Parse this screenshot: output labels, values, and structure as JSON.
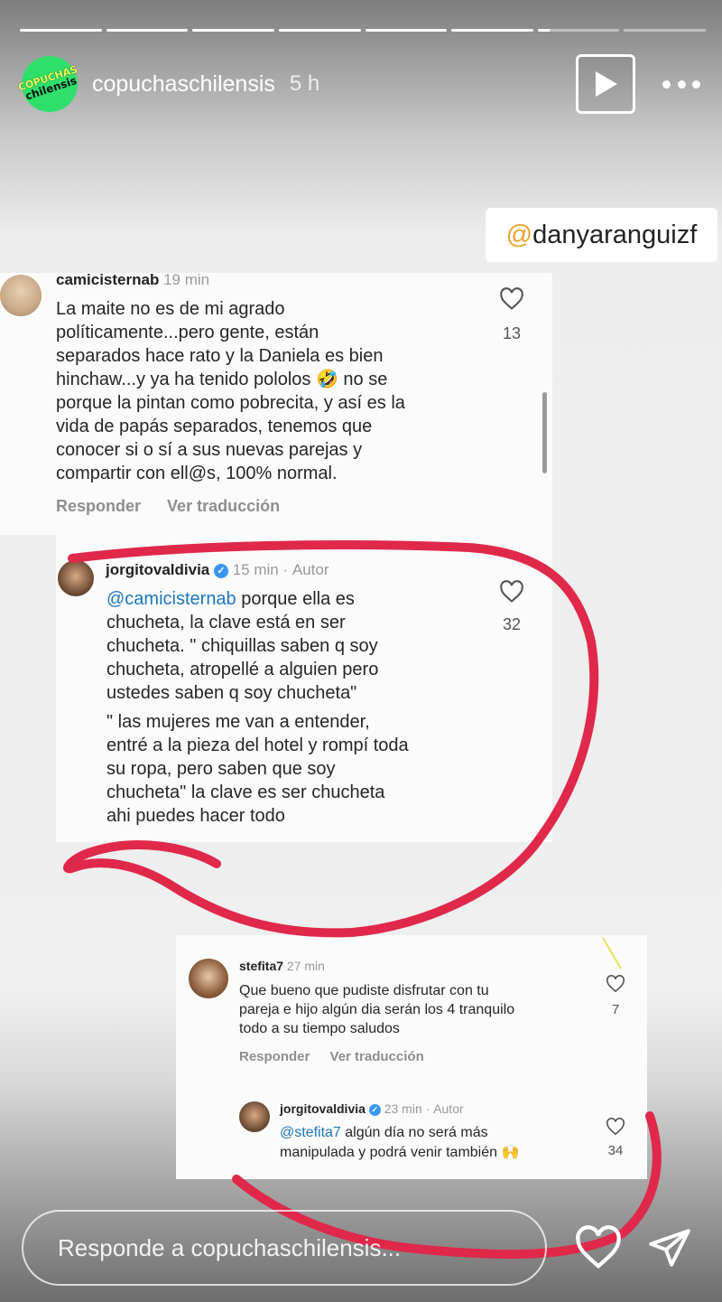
{
  "story": {
    "progress": [
      1,
      1,
      1,
      1,
      1,
      1,
      0.15,
      0
    ],
    "account": {
      "avatar_line1": "COPUCHAS",
      "avatar_line2": "chilensis",
      "username": "copuchaschilensis",
      "time_ago": "5 h"
    },
    "mention_sticker": {
      "prefix": "@",
      "handle": "danyaranguizf"
    },
    "reply_placeholder": "Responde a copuchaschilensis...",
    "icons": [
      "play-icon",
      "more-icon",
      "heart-icon",
      "send-icon"
    ]
  },
  "comments": {
    "c1": {
      "username": "camicisternab",
      "time": "19 min",
      "lines": [
        "La maite no es de mi agrado",
        "políticamente...pero gente, están",
        "separados hace rato y la Daniela es bien",
        "hinchaw...y ya ha tenido pololos 🤣 no se",
        "porque la pintan como pobrecita, y así es la",
        "vida de papás separados, tenemos que",
        "conocer si o sí a sus nuevas parejas y",
        "compartir con ell@s, 100% normal."
      ],
      "likes": "13",
      "reply": "Responder",
      "translate": "Ver traducción"
    },
    "c2": {
      "username": "jorgitovaldivia",
      "time": "15 min",
      "author": "Autor",
      "mention": "@camicisternab",
      "lines": [
        " porque ella es",
        "chucheta, la clave está en ser",
        "chucheta. \" chiquillas saben q soy",
        "chucheta, atropellé a alguien pero",
        "ustedes saben q soy chucheta\"",
        "\" las mujeres me van a entender,",
        "entré a la pieza del hotel y rompí toda",
        "su ropa, pero saben que soy",
        "chucheta\" la clave es ser chucheta",
        "ahi puedes hacer todo"
      ],
      "likes": "32"
    },
    "c3": {
      "username": "stefita7",
      "time": "27 min",
      "lines": [
        "Que bueno que pudiste disfrutar con tu",
        "pareja e hijo algún dia serán los 4 tranquilo",
        "todo a su tiempo saludos"
      ],
      "likes": "7",
      "reply": "Responder",
      "translate": "Ver traducción"
    },
    "c4": {
      "username": "jorgitovaldivia",
      "time": "23 min",
      "author": "Autor",
      "mention": "@stefita7",
      "lines": [
        " algún día no será más",
        "manipulada y podrá venir también 🙌"
      ],
      "likes": "34"
    }
  },
  "colors": {
    "highlight_stroke": "#e0284a",
    "mention_blue": "#1d76bd",
    "avatar_green": "#2ee06a"
  }
}
